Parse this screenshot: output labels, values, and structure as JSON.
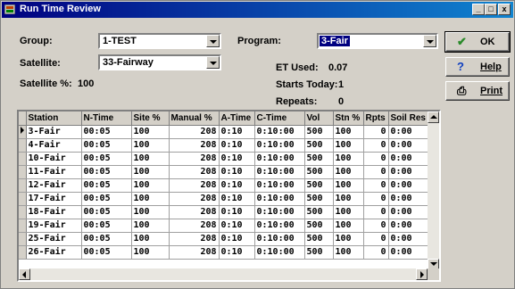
{
  "window": {
    "title": "Run Time Review",
    "controls": [
      "_",
      "□",
      "x"
    ]
  },
  "form": {
    "group_label": "Group:",
    "group_value": "1-TEST",
    "satellite_label": "Satellite:",
    "satellite_value": "33-Fairway",
    "satellite_pct_label": "Satellite %:",
    "satellite_pct_value": "100",
    "program_label": "Program:",
    "program_value": "3-Fair",
    "et_used_label": "ET Used:",
    "et_used_value": "0.07",
    "starts_today_label": "Starts Today:",
    "starts_today_value": "1",
    "repeats_label": "Repeats:",
    "repeats_value": "0"
  },
  "buttons": {
    "ok": "OK",
    "help": "Help",
    "print": "Print"
  },
  "grid": {
    "columns": [
      "Station",
      "N-Time",
      "Site %",
      "Manual %",
      "A-Time",
      "C-Time",
      "Vol",
      "Stn %",
      "Rpts",
      "Soil Res"
    ],
    "rows": [
      [
        "3-Fair",
        "00:05",
        "100",
        "208",
        "0:10",
        "0:10:00",
        "500",
        "100",
        "0",
        "0:00"
      ],
      [
        "4-Fair",
        "00:05",
        "100",
        "208",
        "0:10",
        "0:10:00",
        "500",
        "100",
        "0",
        "0:00"
      ],
      [
        "10-Fair",
        "00:05",
        "100",
        "208",
        "0:10",
        "0:10:00",
        "500",
        "100",
        "0",
        "0:00"
      ],
      [
        "11-Fair",
        "00:05",
        "100",
        "208",
        "0:10",
        "0:10:00",
        "500",
        "100",
        "0",
        "0:00"
      ],
      [
        "12-Fair",
        "00:05",
        "100",
        "208",
        "0:10",
        "0:10:00",
        "500",
        "100",
        "0",
        "0:00"
      ],
      [
        "17-Fair",
        "00:05",
        "100",
        "208",
        "0:10",
        "0:10:00",
        "500",
        "100",
        "0",
        "0:00"
      ],
      [
        "18-Fair",
        "00:05",
        "100",
        "208",
        "0:10",
        "0:10:00",
        "500",
        "100",
        "0",
        "0:00"
      ],
      [
        "19-Fair",
        "00:05",
        "100",
        "208",
        "0:10",
        "0:10:00",
        "500",
        "100",
        "0",
        "0:00"
      ],
      [
        "25-Fair",
        "00:05",
        "100",
        "208",
        "0:10",
        "0:10:00",
        "500",
        "100",
        "0",
        "0:00"
      ],
      [
        "26-Fair",
        "00:05",
        "100",
        "208",
        "0:10",
        "0:10:00",
        "500",
        "100",
        "0",
        "0:00"
      ]
    ],
    "numeric_columns": [
      3,
      8
    ]
  },
  "colors": {
    "titlebar": "#000080",
    "selection": "#000080",
    "ok_check": "#2a8a2a",
    "help_icon": "#1040c0"
  }
}
